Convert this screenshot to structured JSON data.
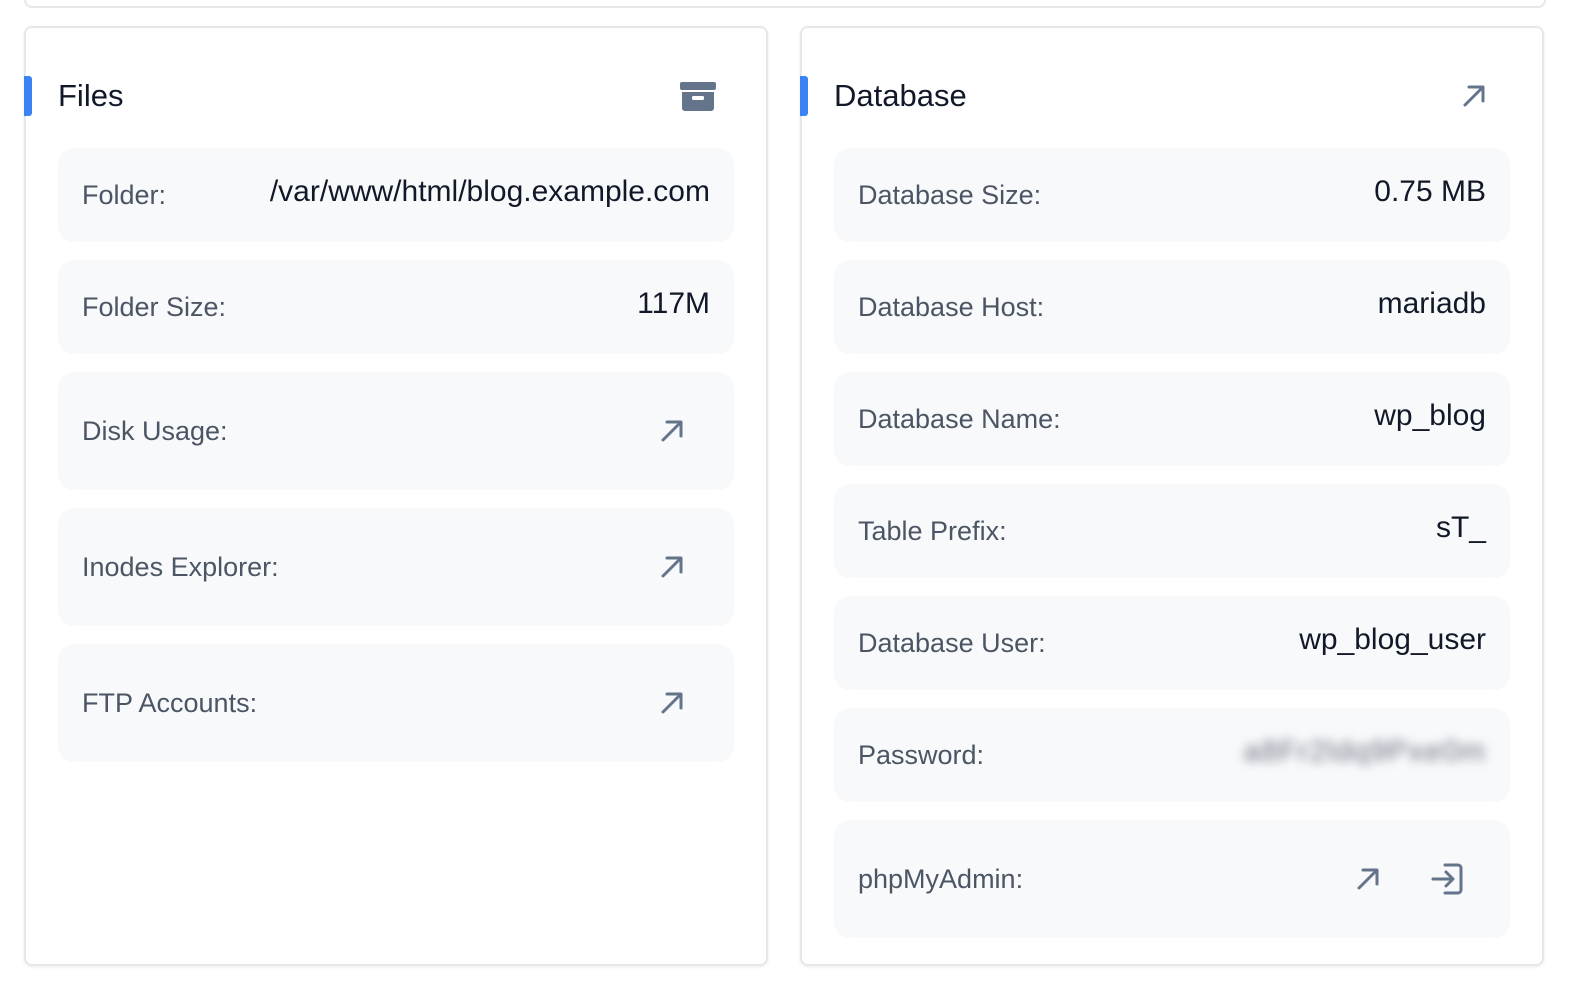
{
  "files": {
    "title": "Files",
    "action_icon": "archive-icon",
    "rows": [
      {
        "label": "Folder:",
        "value": "/var/www/html/blog.example.com"
      },
      {
        "label": "Folder Size:",
        "value": "117M"
      },
      {
        "label": "Disk Usage:",
        "icon": "external-link-icon"
      },
      {
        "label": "Inodes Explorer:",
        "icon": "external-link-icon"
      },
      {
        "label": "FTP Accounts:",
        "icon": "external-link-icon"
      }
    ]
  },
  "database": {
    "title": "Database",
    "action_icon": "external-link-icon",
    "rows": [
      {
        "label": "Database Size:",
        "value": "0.75 MB"
      },
      {
        "label": "Database Host:",
        "value": "mariadb"
      },
      {
        "label": "Database Name:",
        "value": "wp_blog"
      },
      {
        "label": "Table Prefix:",
        "value": "sT_"
      },
      {
        "label": "Database User:",
        "value": "wp_blog_user"
      },
      {
        "label": "Password:",
        "value": "a8Fr2ldq9Pxe0m"
      },
      {
        "label": "phpMyAdmin:",
        "icons": [
          "external-link-icon",
          "login-icon"
        ]
      }
    ]
  },
  "colors": {
    "accent": "#3b82f6",
    "row_bg": "#f8f9fb",
    "icon": "#64748b"
  }
}
